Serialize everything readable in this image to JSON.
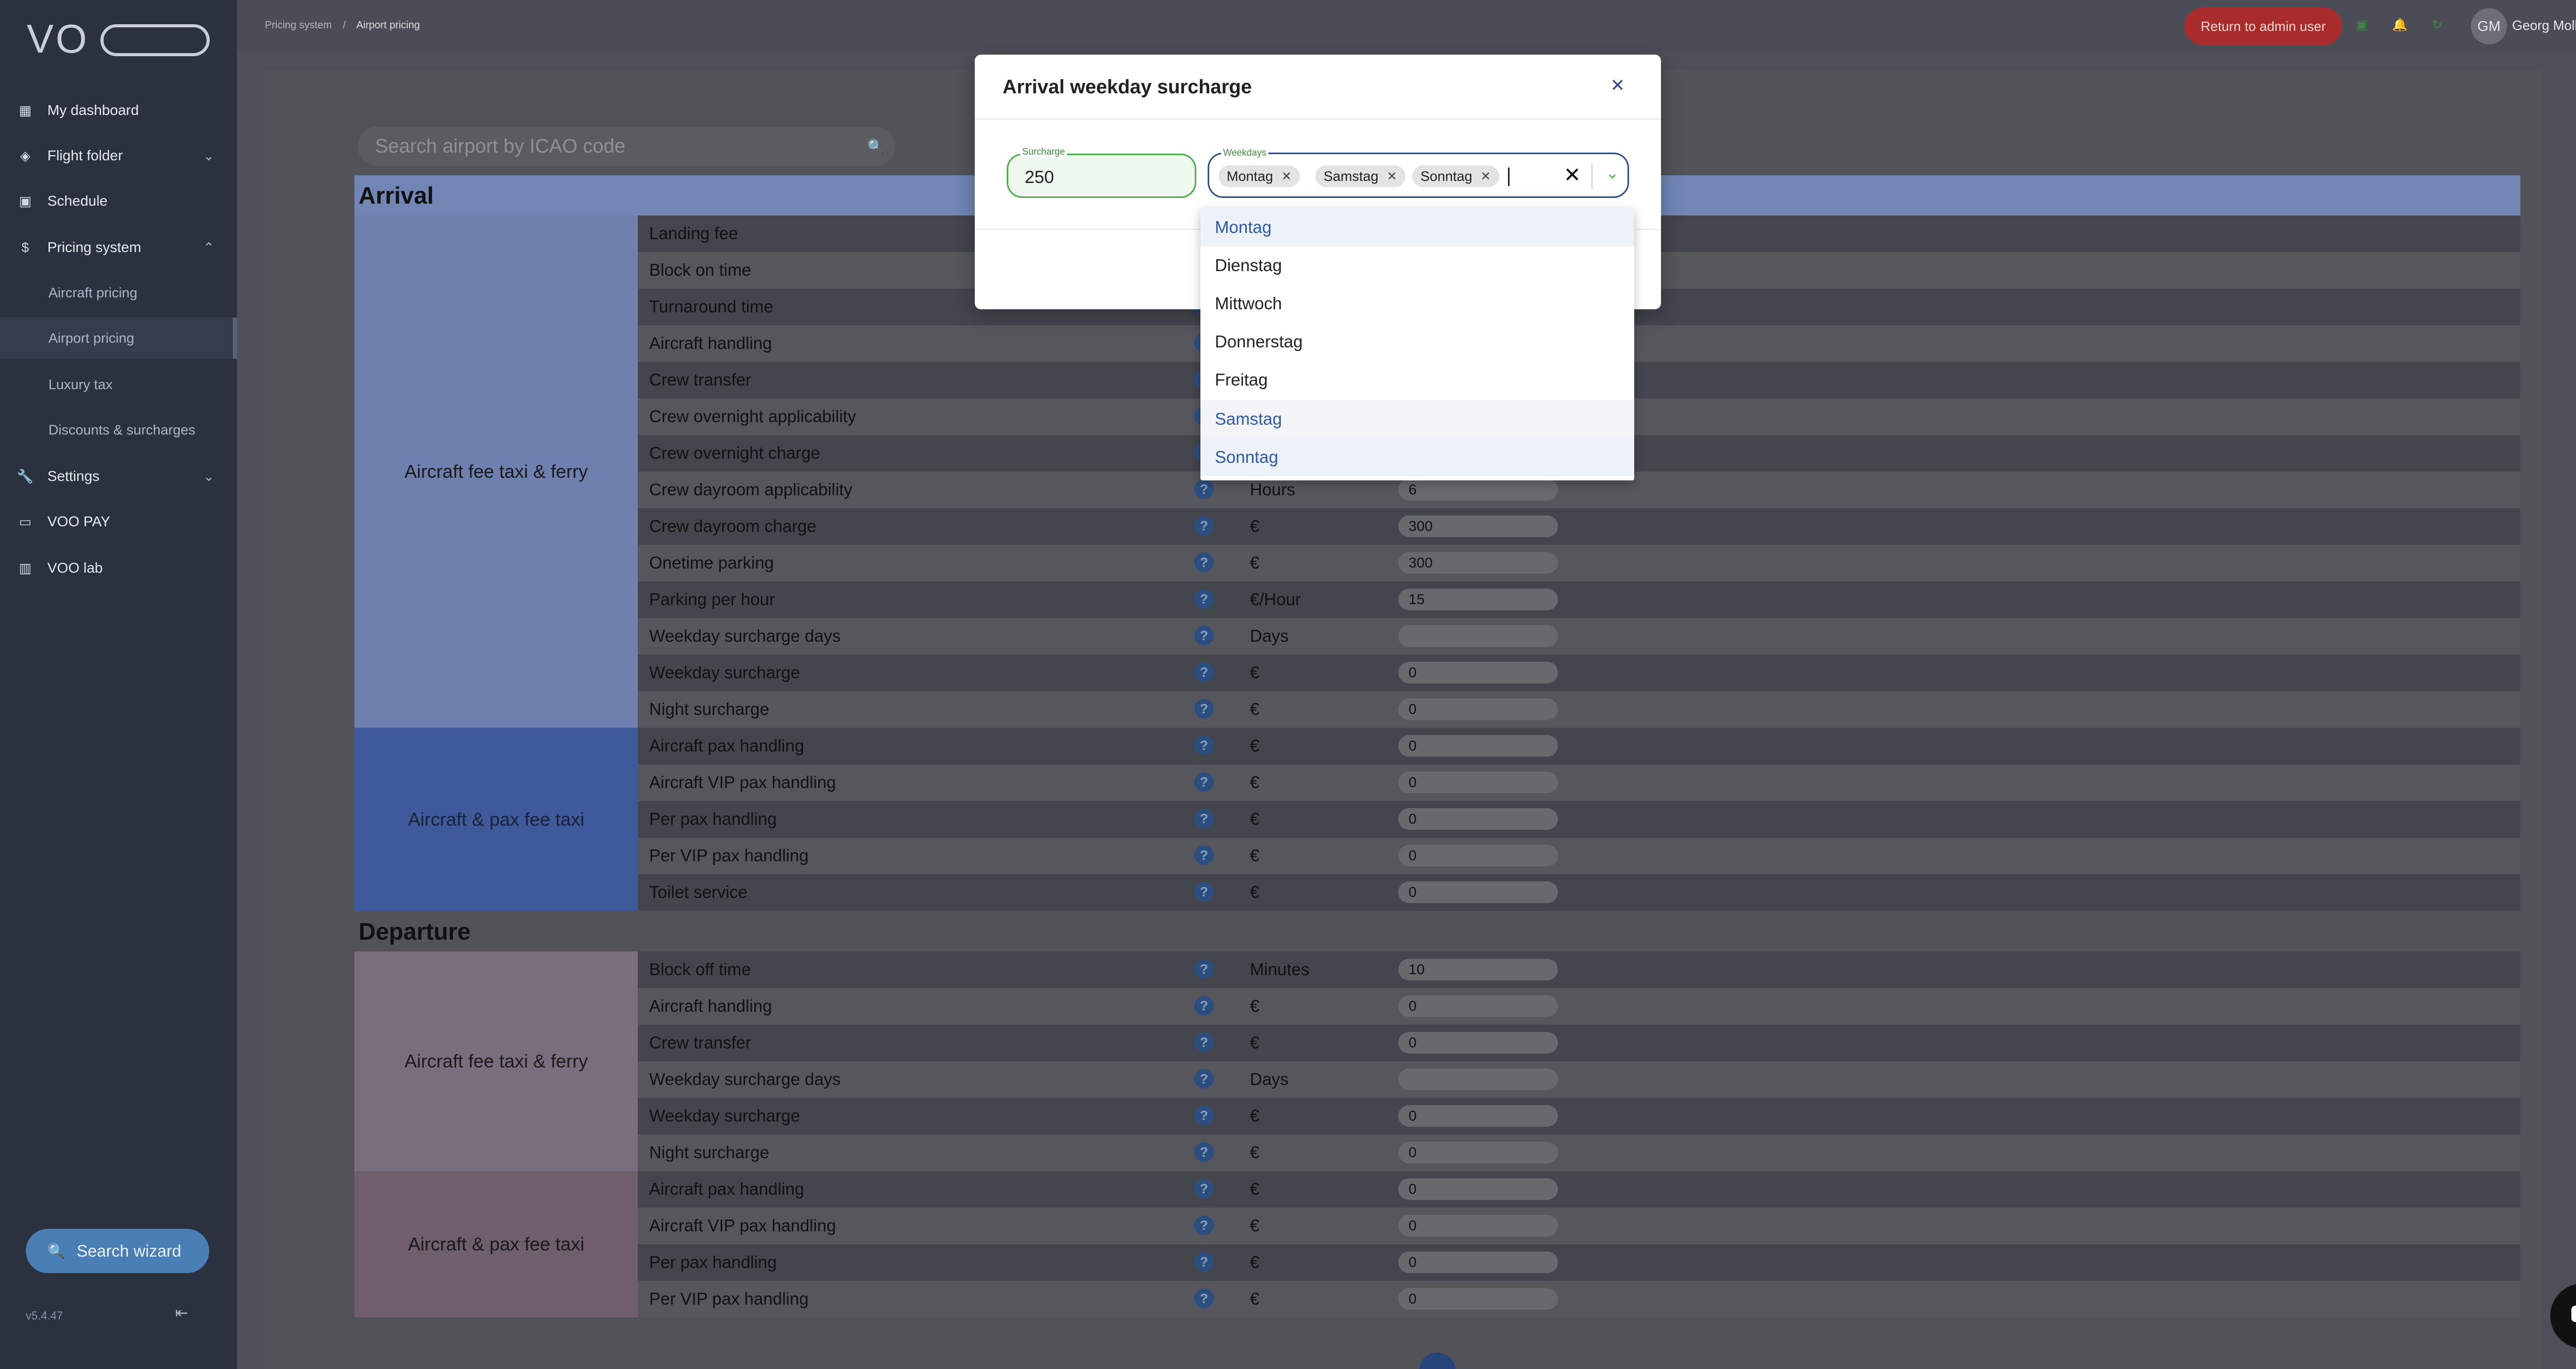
{
  "sidebar": {
    "logo": "VOO",
    "items": [
      {
        "label": "My dashboard",
        "icon": "dashboard-icon"
      },
      {
        "label": "Flight folder",
        "icon": "layers-icon"
      },
      {
        "label": "Schedule",
        "icon": "calendar-icon"
      },
      {
        "label": "Pricing system",
        "icon": "dollar-icon"
      },
      {
        "label": "Settings",
        "icon": "wrench-icon"
      },
      {
        "label": "VOO PAY",
        "icon": "card-icon"
      },
      {
        "label": "VOO lab",
        "icon": "lab-icon"
      }
    ],
    "pricing_sub": [
      "Aircraft pricing",
      "Airport pricing",
      "Luxury tax",
      "Discounts & surcharges"
    ],
    "search_wizard": "Search wizard",
    "version": "v5.4.47"
  },
  "topbar": {
    "breadcrumb_1": "Pricing system",
    "breadcrumb_sep": "/",
    "breadcrumb_2": "Airport pricing",
    "return_btn": "Return to admin user",
    "user_initials": "GM",
    "user_name": "Georg Molk"
  },
  "search": {
    "placeholder": "Search airport by ICAO code"
  },
  "arrival": {
    "title": "Arrival",
    "groups": [
      {
        "label": "Aircraft fee taxi & ferry",
        "rows": [
          {
            "label": "Landing fee",
            "unit": "",
            "value": ""
          },
          {
            "label": "Block on time",
            "unit": "",
            "value": ""
          },
          {
            "label": "Turnaround time",
            "unit": "",
            "value": ""
          },
          {
            "label": "Aircraft handling",
            "unit": "",
            "value": ""
          },
          {
            "label": "Crew transfer",
            "unit": "",
            "value": ""
          },
          {
            "label": "Crew overnight applicability",
            "unit": "",
            "value": ""
          },
          {
            "label": "Crew overnight charge",
            "unit": "",
            "value": ""
          },
          {
            "label": "Crew dayroom applicability",
            "unit": "Hours",
            "value": "6"
          },
          {
            "label": "Crew dayroom charge",
            "unit": "€",
            "value": "300"
          },
          {
            "label": "Onetime parking",
            "unit": "€",
            "value": "300"
          },
          {
            "label": "Parking per hour",
            "unit": "€/Hour",
            "value": "15"
          },
          {
            "label": "Weekday surcharge days",
            "unit": "Days",
            "value": ""
          },
          {
            "label": "Weekday surcharge",
            "unit": "€",
            "value": "0"
          },
          {
            "label": "Night surcharge",
            "unit": "€",
            "value": "0"
          }
        ]
      },
      {
        "label": "Aircraft & pax fee taxi",
        "rows": [
          {
            "label": "Aircraft pax handling",
            "unit": "€",
            "value": "0"
          },
          {
            "label": "Aircraft VIP pax handling",
            "unit": "€",
            "value": "0"
          },
          {
            "label": "Per pax handling",
            "unit": "€",
            "value": "0"
          },
          {
            "label": "Per VIP pax handling",
            "unit": "€",
            "value": "0"
          },
          {
            "label": "Toilet service",
            "unit": "€",
            "value": "0"
          }
        ]
      }
    ]
  },
  "departure": {
    "title": "Departure",
    "groups": [
      {
        "label": "Aircraft fee taxi & ferry",
        "rows": [
          {
            "label": "Block off time",
            "unit": "Minutes",
            "value": "10"
          },
          {
            "label": "Aircraft handling",
            "unit": "€",
            "value": "0"
          },
          {
            "label": "Crew transfer",
            "unit": "€",
            "value": "0"
          },
          {
            "label": "Weekday surcharge days",
            "unit": "Days",
            "value": ""
          },
          {
            "label": "Weekday surcharge",
            "unit": "€",
            "value": "0"
          },
          {
            "label": "Night surcharge",
            "unit": "€",
            "value": "0"
          }
        ]
      },
      {
        "label": "Aircraft & pax fee taxi",
        "rows": [
          {
            "label": "Aircraft pax handling",
            "unit": "€",
            "value": "0"
          },
          {
            "label": "Aircraft VIP pax handling",
            "unit": "€",
            "value": "0"
          },
          {
            "label": "Per pax handling",
            "unit": "€",
            "value": "0"
          },
          {
            "label": "Per VIP pax handling",
            "unit": "€",
            "value": "0"
          }
        ]
      }
    ]
  },
  "modal": {
    "title": "Arrival weekday surcharge",
    "surcharge_label": "Surcharge",
    "surcharge_value": "250",
    "weekdays_label": "Weekdays",
    "selected": [
      "Montag",
      "Samstag",
      "Sonntag"
    ],
    "options": [
      "Montag",
      "Dienstag",
      "Mittwoch",
      "Donnerstag",
      "Freitag",
      "Samstag",
      "Sonntag"
    ]
  },
  "colors": {
    "arrival_header": "#7186b5",
    "arrival_group1": "#6f7fae",
    "arrival_group2": "#3e5a9b",
    "departure_group1": "#7a6d7d",
    "departure_group2": "#6f5f6c",
    "accent_green": "#4fae4f",
    "accent_blue": "#2e4f8c"
  }
}
